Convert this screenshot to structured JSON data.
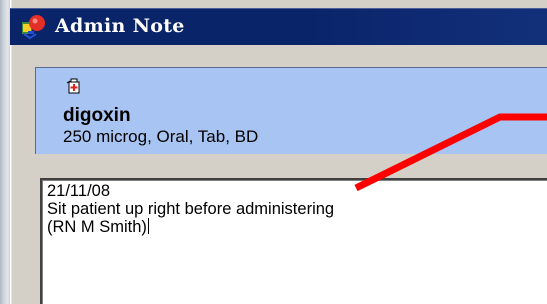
{
  "window": {
    "title": "Admin Note",
    "icon": "admin-note-app-icon"
  },
  "drug": {
    "icon": "medication-icon",
    "name": "digoxin",
    "dose": "250 microg, Oral, Tab, BD"
  },
  "note": {
    "lines": [
      "21/11/08",
      "Sit patient up right before administering",
      "(RN M Smith)"
    ]
  },
  "annotation": {
    "type": "red-pointer-line",
    "color": "#ff0000"
  },
  "colors": {
    "titlebar": "#0a246a",
    "drug_panel": "#a8c4f2",
    "window_bg": "#d4d0c8"
  }
}
